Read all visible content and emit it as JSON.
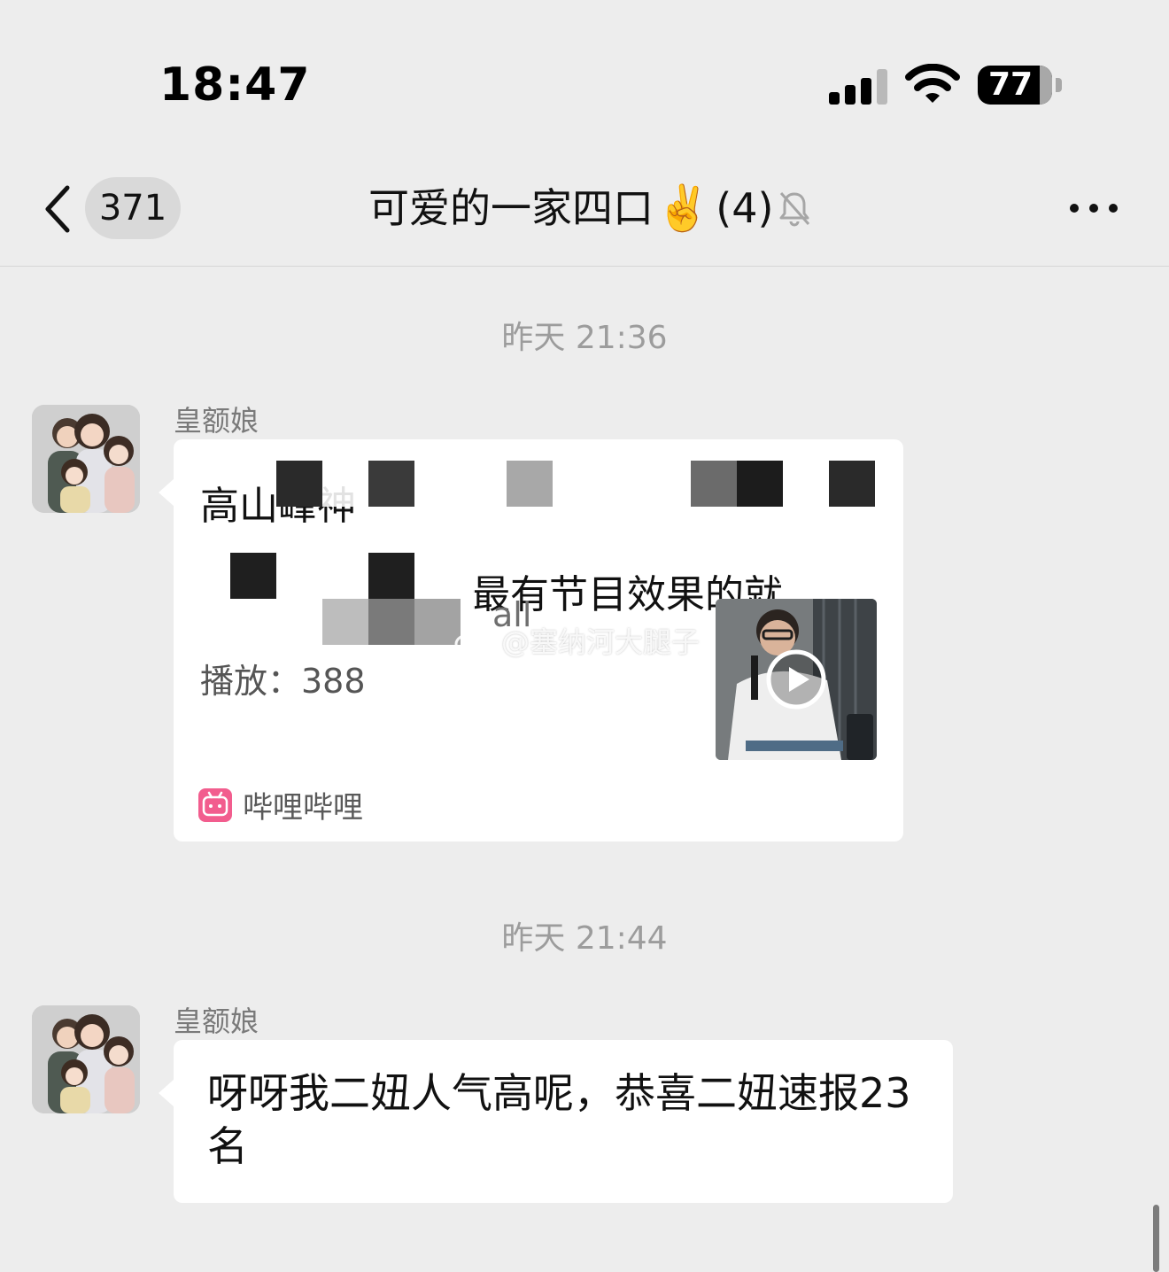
{
  "status_bar": {
    "time": "18:47",
    "battery": "77",
    "battery_level_pct": 77,
    "signal_bars": 3,
    "signal_bars_total": 4
  },
  "nav": {
    "unread_count": "371",
    "title": "可爱的一家四口",
    "title_emoji": "✌️",
    "member_count": "(4)",
    "muted": true
  },
  "messages": [
    {
      "timestamp": "昨天 21:36",
      "sender": "皇额娘",
      "type": "link-card",
      "card": {
        "title_line1": "高山峰神",
        "title_line2": "最有节目效果的就...",
        "desc_fragment": "all",
        "plays": "播放：388",
        "source": "哔哩哔哩"
      }
    },
    {
      "timestamp": "昨天 21:44",
      "sender": "皇额娘",
      "type": "text",
      "text": "呀呀我二妞人气高呢，恭喜二妞速报23名"
    }
  ],
  "watermark": "@塞纳河大腿子",
  "colors": {
    "background": "#ededed",
    "bubble": "#ffffff",
    "timestamp": "#9c9c9c",
    "bilibili_pink": "#f25d8e"
  },
  "icons": [
    "back-chevron-icon",
    "mute-bell-icon",
    "more-dots-icon",
    "play-icon",
    "bilibili-icon",
    "weibo-icon"
  ]
}
